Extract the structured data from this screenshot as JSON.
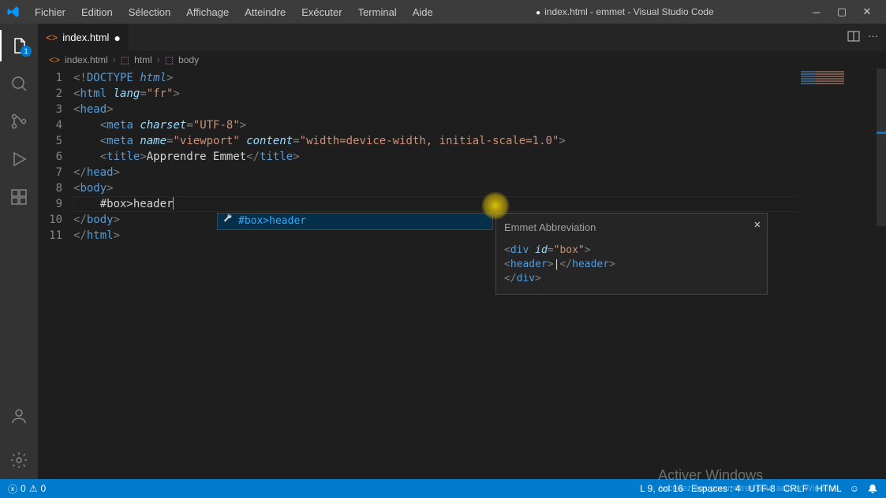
{
  "title": "index.html - emmet - Visual Studio Code",
  "title_dirty": true,
  "menu": [
    "Fichier",
    "Edition",
    "Sélection",
    "Affichage",
    "Atteindre",
    "Exécuter",
    "Terminal",
    "Aide"
  ],
  "activity_badge": "1",
  "tab": {
    "filename": "index.html"
  },
  "breadcrumb": {
    "file": "index.html",
    "part1": "html",
    "part2": "body"
  },
  "code_lines": [
    {
      "n": "1",
      "raw": "<!DOCTYPE html>"
    },
    {
      "n": "2",
      "raw": "<html lang=\"fr\">"
    },
    {
      "n": "3",
      "raw": "<head>"
    },
    {
      "n": "4",
      "raw": "    <meta charset=\"UTF-8\">"
    },
    {
      "n": "5",
      "raw": "    <meta name=\"viewport\" content=\"width=device-width, initial-scale=1.0\">"
    },
    {
      "n": "6",
      "raw": "    <title>Apprendre Emmet</title>"
    },
    {
      "n": "7",
      "raw": "</head>"
    },
    {
      "n": "8",
      "raw": "<body>"
    },
    {
      "n": "9",
      "raw": "    #box>header"
    },
    {
      "n": "10",
      "raw": "</body>"
    },
    {
      "n": "11",
      "raw": "</html>"
    }
  ],
  "suggest": {
    "label": "#box>header"
  },
  "emmet": {
    "title": "Emmet Abbreviation",
    "preview": [
      "<div id=\"box\">",
      "    <header>|</header>",
      "</div>"
    ]
  },
  "status": {
    "errors": "0",
    "warnings": "0",
    "cursor": "L 9, col 16",
    "spaces": "Espaces : 4",
    "encoding": "UTF-8",
    "eol": "CRLF",
    "lang": "HTML"
  },
  "watermark": {
    "line1": "Activer Windows",
    "line2": "Accédez aux paramètres pour activer Windows."
  }
}
